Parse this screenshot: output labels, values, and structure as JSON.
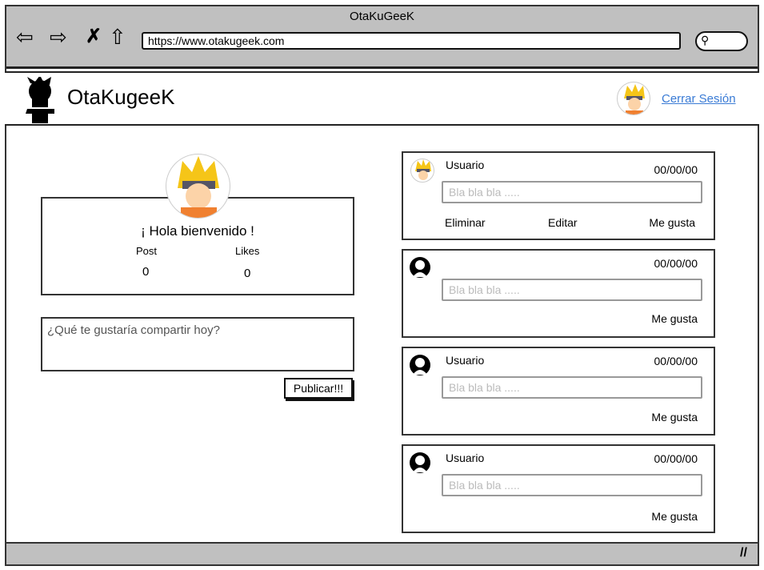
{
  "browser": {
    "title": "OtaKuGeeK",
    "url": "https://www.otakugeek.com"
  },
  "header": {
    "brand": "OtaKugeeK",
    "logout": "Cerrar Sesión"
  },
  "profile": {
    "greeting": "¡ Hola bienvenido !",
    "post_label": "Post",
    "likes_label": "Likes",
    "post_count": "0",
    "likes_count": "0"
  },
  "composer": {
    "placeholder": "¿Qué te gustaría compartir hoy?",
    "publish": "Publicar!!!"
  },
  "posts": [
    {
      "user": "Usuario",
      "date": "00/00/00",
      "text": "Bla bla bla .....",
      "delete": "Eliminar",
      "edit": "Editar",
      "like": "Me gusta"
    },
    {
      "user": "",
      "date": "00/00/00",
      "text": "Bla bla bla .....",
      "like": "Me gusta"
    },
    {
      "user": "Usuario",
      "date": "00/00/00",
      "text": "Bla bla bla .....",
      "like": "Me gusta"
    },
    {
      "user": "Usuario",
      "date": "00/00/00",
      "text": "Bla bla bla .....",
      "like": "Me gusta"
    }
  ]
}
